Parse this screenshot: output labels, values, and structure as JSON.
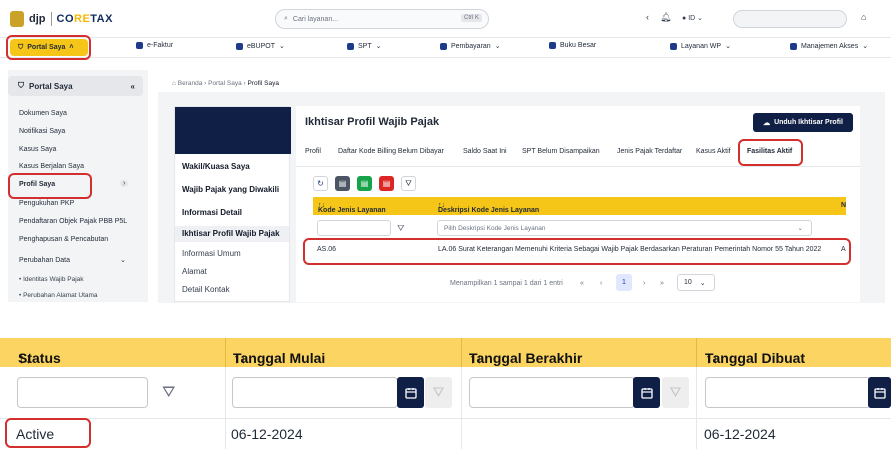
{
  "header": {
    "brand_left": "djp",
    "brand_right_pre": "CO",
    "brand_right_accent": "RE",
    "brand_right_post": "TAX",
    "search_placeholder": "Cari layanan...",
    "search_kbd": "Ctrl K",
    "lang": "ID"
  },
  "nav": {
    "portal": "Portal Saya",
    "items": [
      "e-Faktur",
      "eBUPOT",
      "SPT",
      "Pembayaran",
      "Buku Besar",
      "Layanan WP",
      "Manajemen Akses"
    ]
  },
  "sidebar": {
    "title": "Portal Saya",
    "items": [
      "Dokumen Saya",
      "Notifikasi Saya",
      "Kasus Saya",
      "Kasus Berjalan Saya",
      "Profil Saya",
      "Pengukuhan PKP",
      "Pendaftaran Objek Pajak PBB P5L",
      "Penghapusan & Pencabutan",
      "Perubahan Data"
    ],
    "subitems": [
      "Identitas Wajib Pajak",
      "Perubahan Alamat Utama"
    ]
  },
  "breadcrumb": [
    "Beranda",
    "Portal Saya",
    "Profil Saya"
  ],
  "left_menu": [
    "Wakil/Kuasa Saya",
    "Wajib Pajak yang Diwakili",
    "Informasi Detail",
    "Ikhtisar Profil Wajib Pajak",
    "Informasi Umum",
    "Alamat",
    "Detail Kontak"
  ],
  "main": {
    "title": "Ikhtisar Profil Wajib Pajak",
    "download": "Unduh Ikhtisar Profil",
    "tabs": [
      "Profil",
      "Daftar Kode Billing Belum Dibayar",
      "Saldo Saat Ini",
      "SPT Belum Disampaikan",
      "Jenis Pajak Terdaftar",
      "Kasus Aktif",
      "Fasilitas Aktif"
    ],
    "columns": [
      "Kode Jenis Layanan",
      "Deskripsi Kode Jenis Layanan",
      "N"
    ],
    "filter_placeholder": "Pilih Deskripsi Kode Jenis Layanan",
    "row": {
      "code": "AS.06",
      "desc": "LA.06 Surat Keterangan Memenuhi Kriteria Sebagai Wajib Pajak Berdasarkan Peraturan Pemerintah Nomor 55 Tahun 2022",
      "extra": "A"
    },
    "pagination": {
      "info": "Menampilkan 1 sampai 1 dari 1 entri",
      "first": "«",
      "prev": "‹",
      "page": "1",
      "next": "›",
      "last": "»",
      "size": "10"
    }
  },
  "zoom": {
    "columns": [
      "Status",
      "Tanggal Mulai",
      "Tanggal Berakhir",
      "Tanggal Dibuat"
    ],
    "sort_icon": "↑↓",
    "row": {
      "status": "Active",
      "start": "06-12-2024",
      "end": "",
      "created": "06-12-2024"
    }
  },
  "icons": [
    "search-icon",
    "chevron-left-icon",
    "bell-icon",
    "home-icon",
    "refresh-icon",
    "pdf-icon",
    "filter-icon",
    "calendar-icon"
  ]
}
